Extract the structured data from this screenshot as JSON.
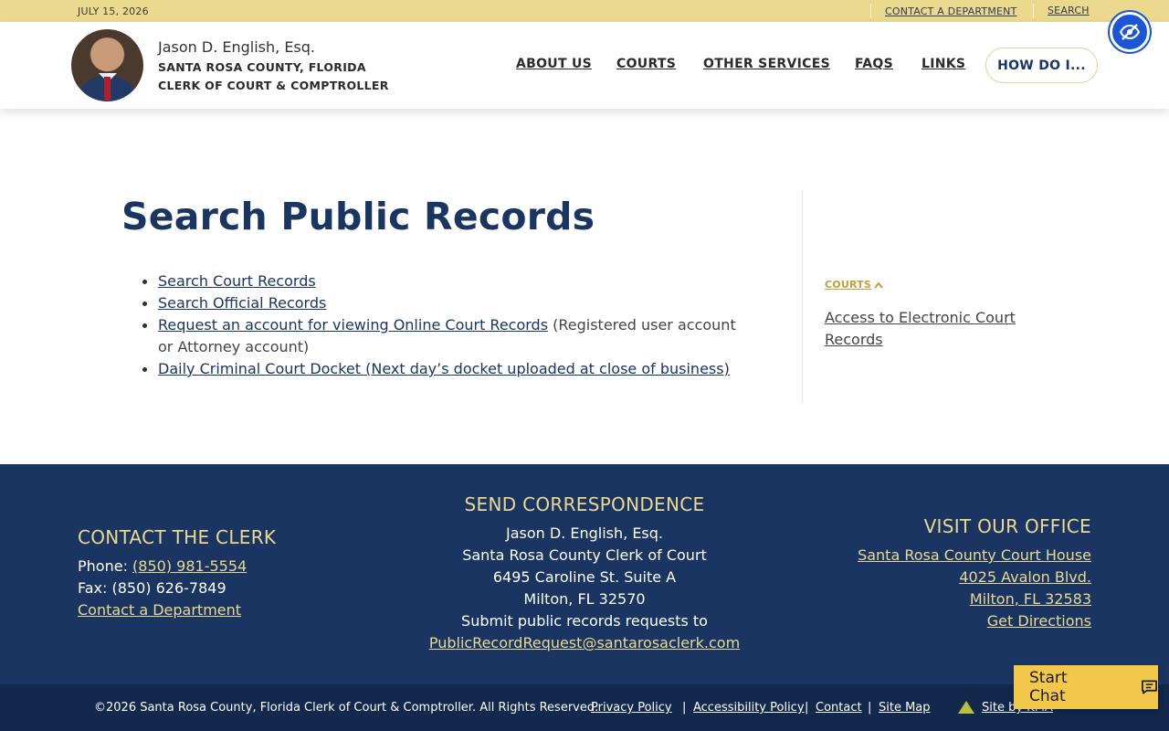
{
  "topbar": {
    "date": "JULY 15, 2026",
    "contact_link": "CONTACT A DEPARTMENT",
    "search_link": "SEARCH"
  },
  "header": {
    "name": "Jason D. English, Esq.",
    "line1": "SANTA ROSA COUNTY, FLORIDA",
    "line2": "CLERK OF COURT & COMPTROLLER",
    "nav": [
      "ABOUT US",
      "COURTS",
      "OTHER SERVICES",
      "FAQS",
      "LINKS"
    ],
    "how_do_i": "HOW DO I..."
  },
  "main": {
    "title": "Search Public Records",
    "items": [
      {
        "link": "Search Court Records",
        "suffix": ""
      },
      {
        "link": "Search Official Records",
        "suffix": ""
      },
      {
        "link": "Request an account for viewing Online Court Records",
        "suffix": " (Registered user account or Attorney account)"
      },
      {
        "link": "Daily Criminal Court Docket (Next day’s docket uploaded at close of business)",
        "suffix": ""
      }
    ]
  },
  "sidebar": {
    "heading": "COURTS",
    "link": "Access to Electronic Court Records"
  },
  "footer": {
    "contact": {
      "heading": "CONTACT THE CLERK",
      "phone_label": "Phone: ",
      "phone": "(850) 981-5554",
      "fax": "Fax: (850) 626-7849",
      "contact_link": "Contact a Department"
    },
    "correspondence": {
      "heading": "SEND CORRESPONDENCE",
      "lines": [
        "Jason D. English, Esq.",
        "Santa Rosa County Clerk of Court",
        "6495 Caroline St. Suite A",
        "Milton, FL 32570",
        "Submit public records requests to"
      ],
      "email": "PublicRecordRequest@santarosaclerk.com"
    },
    "office": {
      "heading": "VISIT OUR OFFICE",
      "links": [
        "Santa Rosa County Court House",
        "4025 Avalon Blvd.",
        "Milton, FL 32583",
        "Get Directions"
      ]
    }
  },
  "bottom": {
    "copyright": "©2026 Santa Rosa County, Florida Clerk of Court & Comptroller. All Rights Reserved.",
    "links": [
      "Privacy Policy",
      "Accessibility Policy",
      "Contact",
      "Site Map"
    ],
    "site_by": "Site by KMA"
  },
  "chat": {
    "label": "Start Chat"
  },
  "icons": {
    "accessibility": "eye-off-icon",
    "chat": "chat-bubble-icon",
    "chevron": "chevron-up-icon"
  },
  "colors": {
    "navy": "#1b3563",
    "gold": "#ebd98e",
    "chat": "#f2c84b",
    "a11y": "#1a56d6"
  }
}
